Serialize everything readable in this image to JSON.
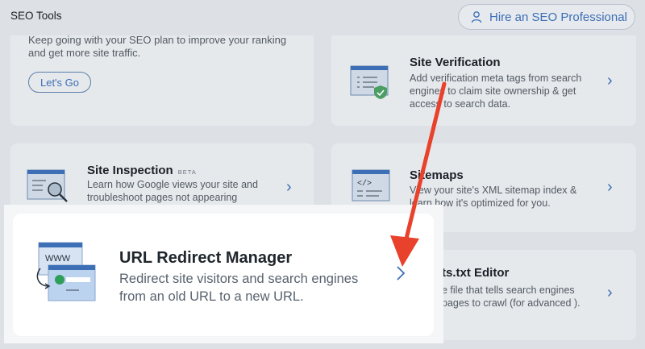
{
  "app": {
    "title": "SEO Tools"
  },
  "header": {
    "hire_label": "Hire an SEO Professional"
  },
  "cards": {
    "plan": {
      "desc": "Keep going with your SEO plan to improve your ranking and get more site traffic.",
      "button_label": "Let's Go"
    },
    "verification": {
      "title": "Site Verification",
      "desc": "Add verification meta tags from search engines to claim site ownership & get access to search data."
    },
    "inspection": {
      "title": "Site Inspection",
      "badge": "BETA",
      "desc": "Learn how Google views your site and troubleshoot pages not appearing"
    },
    "sitemaps": {
      "title": "Sitemaps",
      "desc": "View your site's XML sitemap index & learn how it's optimized for you."
    },
    "robots": {
      "title": "ts.txt Editor",
      "desc": "e file that tells search engines pages to crawl (for advanced )."
    },
    "redirect": {
      "title": "URL Redirect Manager",
      "desc": "Redirect site visitors and search engines from an old URL to a new URL.",
      "icon_text": "WWW"
    }
  },
  "colors": {
    "accent": "#3d6fb6",
    "annotation_arrow": "#e8412c",
    "overlay": "#dde1e5"
  },
  "icons": [
    "person-icon",
    "chevron-right-icon",
    "checkmark-shield-icon",
    "magnifier-icon",
    "code-icon",
    "redirect-arrow-icon"
  ]
}
